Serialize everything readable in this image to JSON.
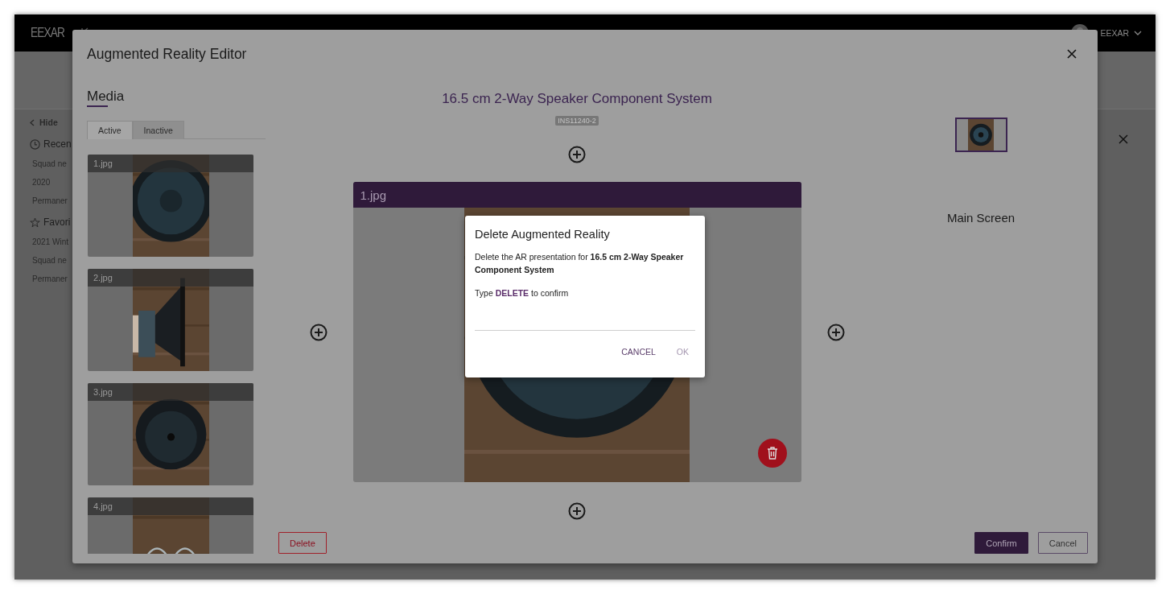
{
  "topbar": {
    "logo": "EEXAR",
    "user": "EEXAR"
  },
  "sidebar": {
    "hide": "Hide",
    "sections": [
      {
        "kind": "recent",
        "title": "Recen",
        "items": [
          "Squad ne",
          "2020",
          "Permaner"
        ]
      },
      {
        "kind": "favorites",
        "title": "Favori",
        "items": [
          "2021 Wint",
          "Squad ne",
          "Permaner"
        ]
      }
    ]
  },
  "editor": {
    "title": "Augmented Reality Editor",
    "media_heading": "Media",
    "tabs": [
      {
        "label": "Active",
        "selected": true
      },
      {
        "label": "Inactive",
        "selected": false
      }
    ],
    "media": [
      {
        "name": "1.jpg"
      },
      {
        "name": "2.jpg"
      },
      {
        "name": "3.jpg"
      },
      {
        "name": "4.jpg"
      }
    ],
    "product_title": "16.5 cm 2-Way Speaker Component System",
    "product_code": "INS11240-2",
    "preview": {
      "name": "1.jpg"
    },
    "main_screen_label": "Main Screen",
    "buttons": {
      "delete": "Delete",
      "confirm": "Confirm",
      "cancel": "Cancel"
    }
  },
  "dialog": {
    "title": "Delete Augmented Reality",
    "message": "Delete the AR presentation for **16.5 cm 2-Way Speaker Component System**",
    "prompt": "Type **DELETE** to confirm",
    "actions": [
      {
        "label": "CANCEL",
        "disabled": false
      },
      {
        "label": "OK",
        "disabled": true
      }
    ]
  }
}
